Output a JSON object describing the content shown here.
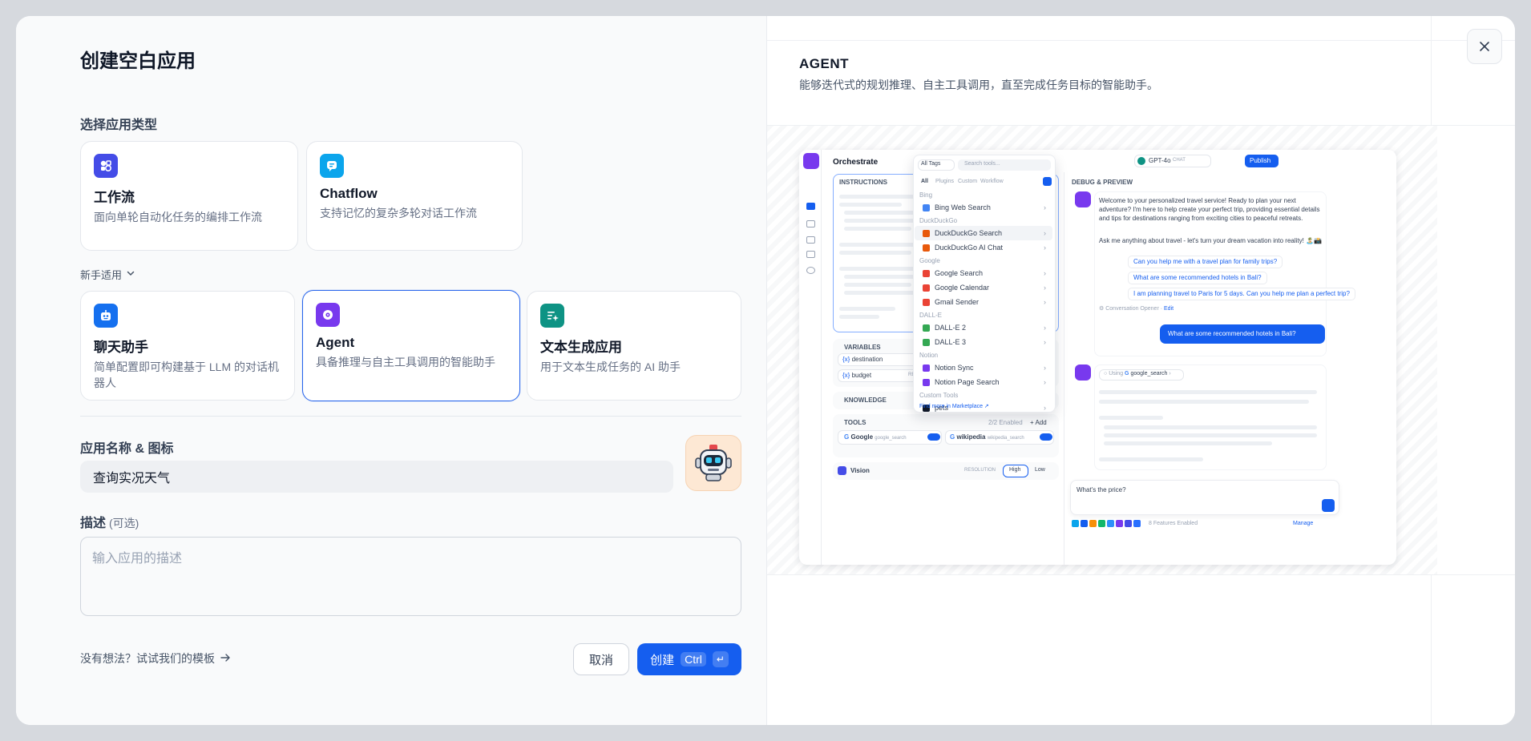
{
  "modal": {
    "title": "创建空白应用",
    "section_app_type": "选择应用类型",
    "cards_top": [
      {
        "name": "工作流",
        "desc": "面向单轮自动化任务的编排工作流",
        "color": "#444ce7"
      },
      {
        "name": "Chatflow",
        "desc": "支持记忆的复杂多轮对话工作流",
        "color": "#0ba5ec"
      }
    ],
    "beginner_label": "新手适用",
    "cards_bottom": [
      {
        "name": "聊天助手",
        "desc": "简单配置即可构建基于 LLM 的对话机器人",
        "color": "#1570ef"
      },
      {
        "name": "Agent",
        "desc": "具备推理与自主工具调用的智能助手",
        "color": "#7839ee",
        "selected": true
      },
      {
        "name": "文本生成应用",
        "desc": "用于文本生成任务的 AI 助手",
        "color": "#0e9384"
      }
    ],
    "section_name_icon": "应用名称 & 图标",
    "app_name_value": "查询实况天气",
    "section_desc": "描述",
    "section_desc_optional": "(可选)",
    "desc_placeholder": "输入应用的描述",
    "template_link": "没有想法？试试我们的模板",
    "cancel_label": "取消",
    "create_label": "创建",
    "create_kbd": "Ctrl",
    "accent_color": "#155eef"
  },
  "preview": {
    "heading": "AGENT",
    "description": "能够迭代式的规划推理、自主工具调用，直至完成任务目标的智能助手。",
    "mock": {
      "orchestrate": "Orchestrate",
      "instructions": "INSTRUCTIONS",
      "variables": "VARIABLES",
      "var1": "destination",
      "var2": "budget",
      "required": "REQUIRED",
      "knowledge": "KNOWLEDGE",
      "tools": "TOOLS",
      "tools_enabled": "2/2 Enabled",
      "add": "Add",
      "tool1_name": "Google",
      "tool1_id": "google_search",
      "tool2_name": "wikipedia",
      "tool2_id": "wikipedia_search",
      "vision": "Vision",
      "resolution": "RESOLUTION",
      "high": "High",
      "low": "Low",
      "all_tags": "All Tags",
      "search_tools": "Search tools...",
      "filters": [
        "All",
        "Plugins",
        "Custom",
        "Workflow"
      ],
      "groups": [
        {
          "head": "Bing",
          "items": [
            "Bing Web Search"
          ]
        },
        {
          "head": "DuckDuckGo",
          "items": [
            "DuckDuckGo Search",
            "DuckDuckGo AI Chat"
          ]
        },
        {
          "head": "Google",
          "items": [
            "Google Search",
            "Google Calendar",
            "Gmail Sender"
          ]
        },
        {
          "head": "DALL-E",
          "items": [
            "DALL-E 2",
            "DALL-E 3"
          ]
        },
        {
          "head": "Notion",
          "items": [
            "Notion Sync",
            "Notion Page Search"
          ]
        },
        {
          "head": "Custom Tools",
          "items": [
            "pets"
          ]
        }
      ],
      "find_more": "Find more in Marketplace ↗",
      "model": "GPT-4o",
      "model_tag": "CHAT",
      "publish": "Publish",
      "debug": "DEBUG & PREVIEW",
      "welcome": "Welcome to your personalized travel service! Ready to plan your next adventure? I'm here to help create your perfect trip, providing essential details and tips for destinations ranging from exciting cities to peaceful retreats.",
      "ask": "Ask me anything about travel - let's turn your dream vacation into reality! 🏝️📸",
      "suggestions": [
        "Can you help me with a travel plan for family trips?",
        "What are some recommended hotels in Bali?",
        "I am planning travel to Paris for 5 days. Can you help me plan a perfect trip?"
      ],
      "opener": "Conversation Opener",
      "edit": "Edit",
      "user_msg": "What are some recommended hotels in Bali?",
      "using": "Using",
      "using_tool": "google_search",
      "input_text": "What's the price?",
      "features": "8 Features Enabled",
      "manage": "Manage"
    }
  }
}
